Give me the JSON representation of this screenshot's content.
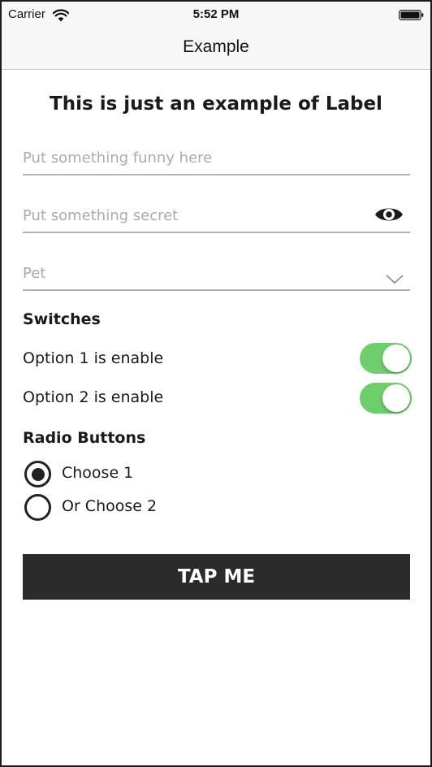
{
  "status_bar": {
    "carrier": "Carrier",
    "time": "5:52 PM",
    "wifi_icon": "wifi-icon",
    "battery_icon": "battery-icon"
  },
  "nav_bar": {
    "title": "Example"
  },
  "content": {
    "label": "This is just an example of Label",
    "text_field": {
      "placeholder": "Put something funny here",
      "value": ""
    },
    "secret_field": {
      "placeholder": "Put something secret",
      "value": "",
      "icon": "eye-icon"
    },
    "pet_select": {
      "placeholder": "Pet",
      "value": "",
      "icon": "chevron-down-icon"
    },
    "switches": {
      "title": "Switches",
      "items": [
        {
          "label": "Option 1 is enable",
          "on": true
        },
        {
          "label": "Option 2 is enable",
          "on": true
        }
      ]
    },
    "radios": {
      "title": "Radio Buttons",
      "items": [
        {
          "label": "Choose 1",
          "selected": true
        },
        {
          "label": "Or Choose 2",
          "selected": false
        }
      ]
    },
    "button": {
      "label": "TAP ME"
    }
  },
  "colors": {
    "switch_on": "#6fce6c",
    "button_bg": "#2b2b2b",
    "placeholder": "#ababab",
    "field_underline": "#b3b3b3",
    "chevron": "#9c6b86"
  }
}
